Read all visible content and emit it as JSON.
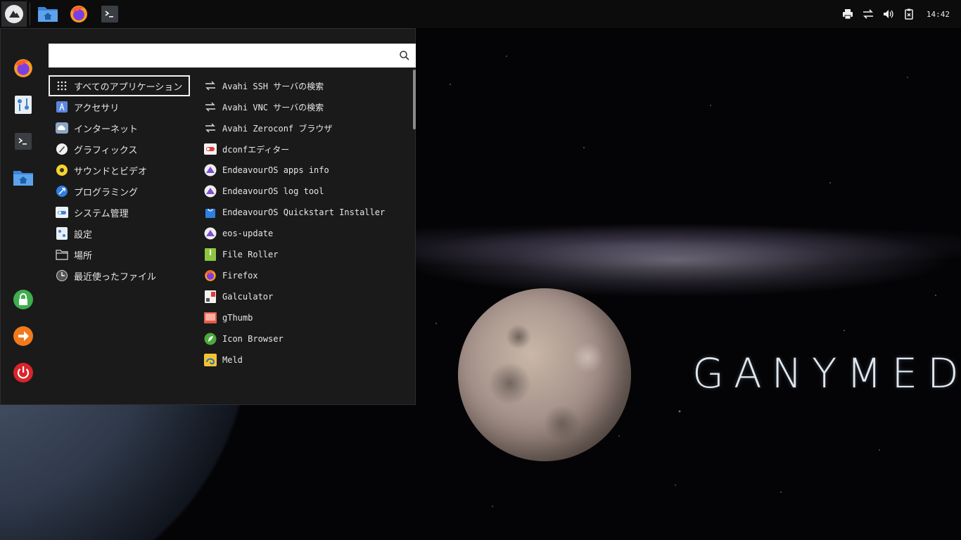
{
  "wallpaper": {
    "title": "GANYMEDE"
  },
  "panel": {
    "launchers": [
      {
        "name": "home-folder",
        "icon": "folder-home-icon"
      },
      {
        "name": "firefox",
        "icon": "firefox-icon"
      },
      {
        "name": "terminal",
        "icon": "terminal-icon"
      }
    ],
    "clock": "14:42"
  },
  "menu": {
    "search": {
      "value": "",
      "placeholder": ""
    },
    "categories": [
      {
        "label": "すべてのアプリケーション",
        "icon": "grid-icon",
        "selected": true
      },
      {
        "label": "アクセサリ",
        "icon": "accessories-icon"
      },
      {
        "label": "インターネット",
        "icon": "cloud-icon"
      },
      {
        "label": "グラフィックス",
        "icon": "graphics-icon"
      },
      {
        "label": "サウンドとビデオ",
        "icon": "multimedia-icon"
      },
      {
        "label": "プログラミング",
        "icon": "development-icon"
      },
      {
        "label": "システム管理",
        "icon": "system-icon"
      },
      {
        "label": "設定",
        "icon": "settings-icon"
      },
      {
        "label": "場所",
        "icon": "folder-icon"
      },
      {
        "label": "最近使ったファイル",
        "icon": "recent-icon"
      }
    ],
    "apps": [
      {
        "label": "Avahi SSH サーバの検索",
        "icon": "network-arrows-icon"
      },
      {
        "label": "Avahi VNC サーバの検索",
        "icon": "network-arrows-icon"
      },
      {
        "label": "Avahi Zeroconf ブラウザ",
        "icon": "network-arrows-icon"
      },
      {
        "label": "dconfエディター",
        "icon": "dconf-icon"
      },
      {
        "label": "EndeavourOS apps info",
        "icon": "endeavouros-icon"
      },
      {
        "label": "EndeavourOS log tool",
        "icon": "endeavouros-icon"
      },
      {
        "label": "EndeavourOS Quickstart Installer",
        "icon": "installer-bag-icon"
      },
      {
        "label": "eos-update",
        "icon": "endeavouros-icon"
      },
      {
        "label": "File Roller",
        "icon": "archive-icon"
      },
      {
        "label": "Firefox",
        "icon": "firefox-icon"
      },
      {
        "label": "Galculator",
        "icon": "calculator-icon"
      },
      {
        "label": "gThumb",
        "icon": "image-viewer-icon"
      },
      {
        "label": "Icon Browser",
        "icon": "icon-browser-icon"
      },
      {
        "label": "Meld",
        "icon": "meld-icon"
      }
    ],
    "favorites": [
      {
        "name": "firefox",
        "icon": "firefox-icon"
      },
      {
        "name": "settings-manager",
        "icon": "settings-manager-icon"
      },
      {
        "name": "terminal",
        "icon": "terminal-icon"
      },
      {
        "name": "file-manager",
        "icon": "folder-home-icon"
      }
    ],
    "session": [
      {
        "name": "lock-screen",
        "icon": "lock-icon",
        "color": "#3fae4e"
      },
      {
        "name": "switch-user",
        "icon": "arrow-right-icon",
        "color": "#f07a1c"
      },
      {
        "name": "log-out",
        "icon": "power-icon",
        "color": "#d9242c"
      }
    ]
  }
}
